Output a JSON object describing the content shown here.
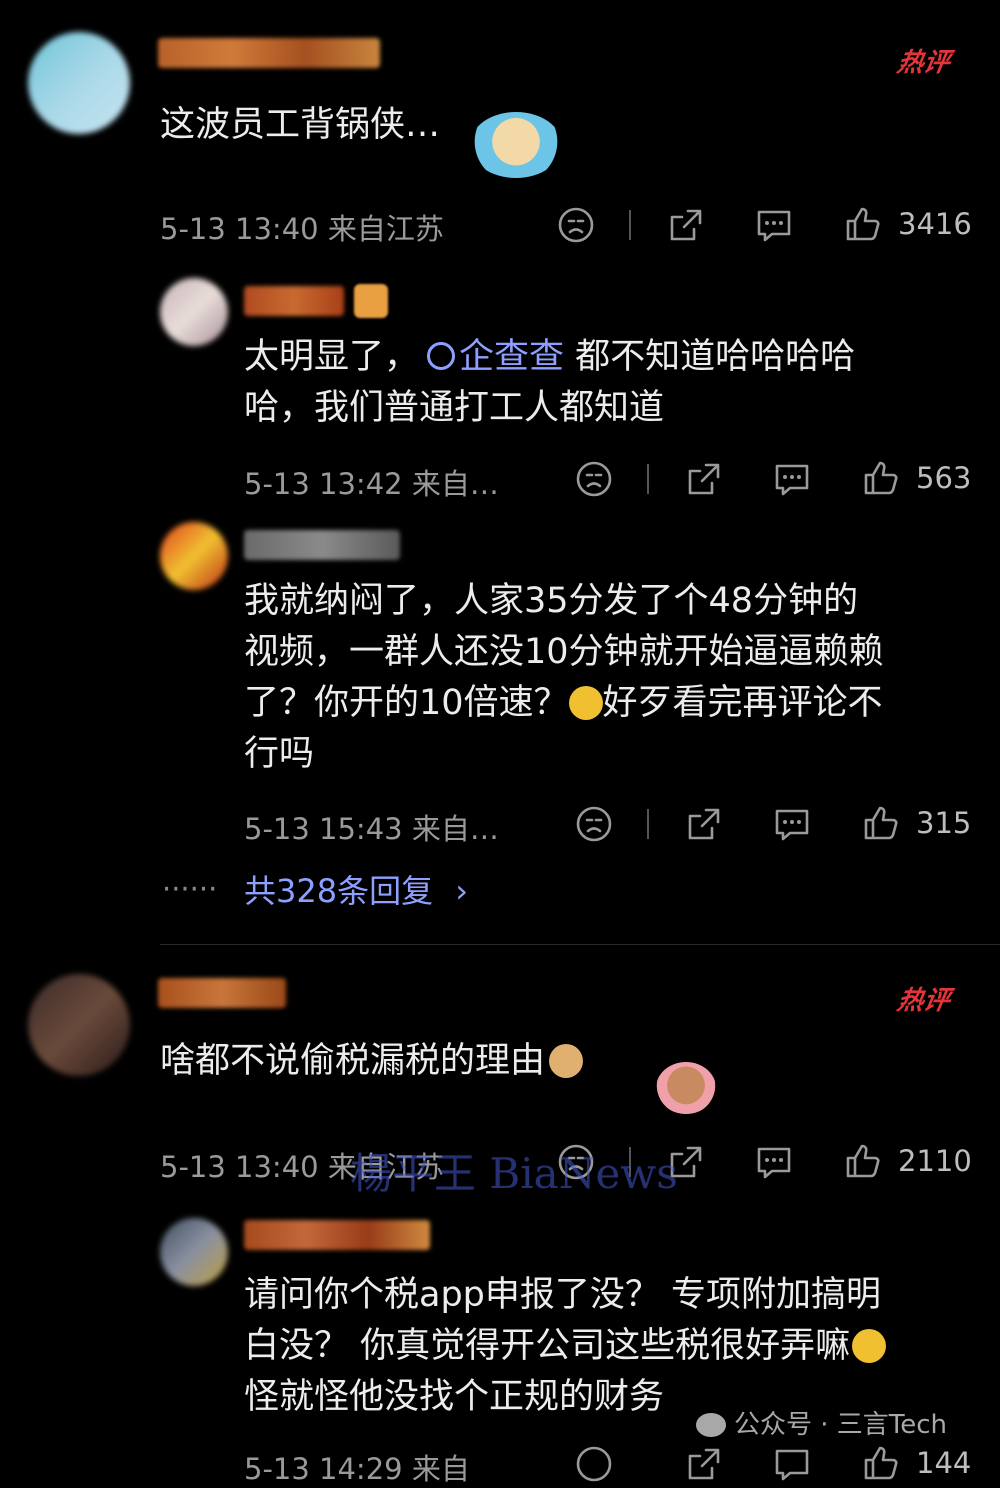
{
  "comments": [
    {
      "text": "这波员工背锅侠…",
      "time": "5-13 13:40",
      "location": "来自江苏",
      "likes": "3416",
      "badge": "热评"
    },
    {
      "text_before_link": "太明显了，",
      "link": "企查查",
      "text_after_link_line1": " 都不知道哈哈哈哈",
      "text_line2": "哈，我们普通打工人都知道",
      "time": "5-13 13:42",
      "location": "来自…",
      "likes": "563"
    },
    {
      "line1": "我就纳闷了，人家35分发了个48分钟的",
      "line2": "视频，一群人还没10分钟就开始逼逼赖赖",
      "line3a": "了？你开的10倍速？",
      "line3b": "好歹看完再评论不",
      "line4": "行吗",
      "time": "5-13 15:43",
      "location": "来自…",
      "likes": "315"
    },
    {
      "text": "啥都不说偷税漏税的理由",
      "time": "5-13 13:40",
      "location": "来自江苏",
      "likes": "2110",
      "badge": "热评"
    },
    {
      "line1": "请问你个税app申报了没？ 专项附加搞明",
      "line2": "白没？ 你真觉得开公司这些税很好弄嘛",
      "line3": "怪就怪他没找个正规的财务",
      "time": "5-13 14:29",
      "location": "来自",
      "likes": "144"
    }
  ],
  "replies_link": {
    "dots": "······",
    "label": "共328条回复",
    "chevron": "›"
  },
  "watermark": "楊平王 BiaNews",
  "footer": {
    "prefix": "公众号 · ",
    "name": "三言Tech"
  },
  "icons": [
    "dislike-icon",
    "share-icon",
    "comment-icon",
    "like-icon",
    "chevron-right-icon",
    "wechat-icon"
  ],
  "colors": {
    "background": "#000000",
    "link": "#8ea0ff",
    "hot_badge": "#e2363a",
    "meta": "#9a9a9a"
  }
}
